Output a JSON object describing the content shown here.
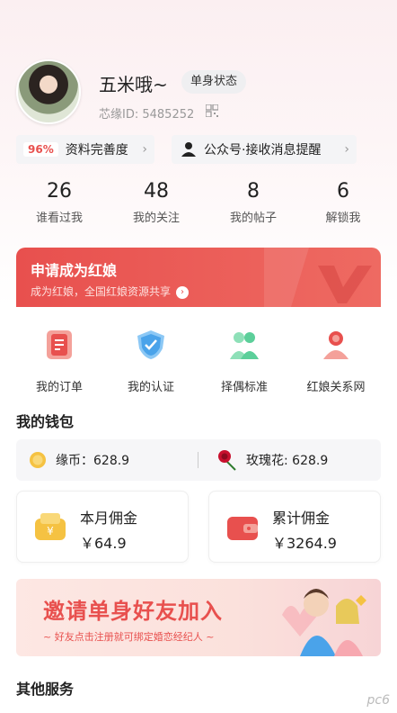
{
  "profile": {
    "nickname": "五米哦~",
    "status": "单身状态",
    "id_label": "芯缘ID: 5485252"
  },
  "chips": {
    "profile_percent": "96%",
    "profile_label": "资料完善度",
    "wechat_label": "公众号·接收消息提醒"
  },
  "stats": [
    {
      "value": "26",
      "label": "谁看过我"
    },
    {
      "value": "48",
      "label": "我的关注"
    },
    {
      "value": "8",
      "label": "我的帖子"
    },
    {
      "value": "6",
      "label": "解锁我"
    }
  ],
  "banner": {
    "title": "申请成为红娘",
    "subtitle": "成为红娘，全国红娘资源共享"
  },
  "quick": [
    {
      "label": "我的订单",
      "icon": "order-icon"
    },
    {
      "label": "我的认证",
      "icon": "verify-shield-icon"
    },
    {
      "label": "择偶标准",
      "icon": "couple-icon"
    },
    {
      "label": "红娘关系网",
      "icon": "matchmaker-icon"
    }
  ],
  "wallet": {
    "title": "我的钱包",
    "coin_label": "缘币：628.9",
    "rose_label": "玫瑰花: 628.9",
    "month_title": "本月佣金",
    "month_amount": "￥64.9",
    "total_title": "累计佣金",
    "total_amount": "￥3264.9"
  },
  "invite": {
    "title": "邀请单身好友加入",
    "subtitle": "~ 好友点击注册就可绑定婚恋经纪人 ~"
  },
  "other": {
    "title": "其他服务"
  },
  "watermark": "pc6",
  "colors": {
    "accent": "#e8504e",
    "gold": "#f5c242",
    "blue": "#4aa3ea",
    "green": "#5ccf9a"
  }
}
